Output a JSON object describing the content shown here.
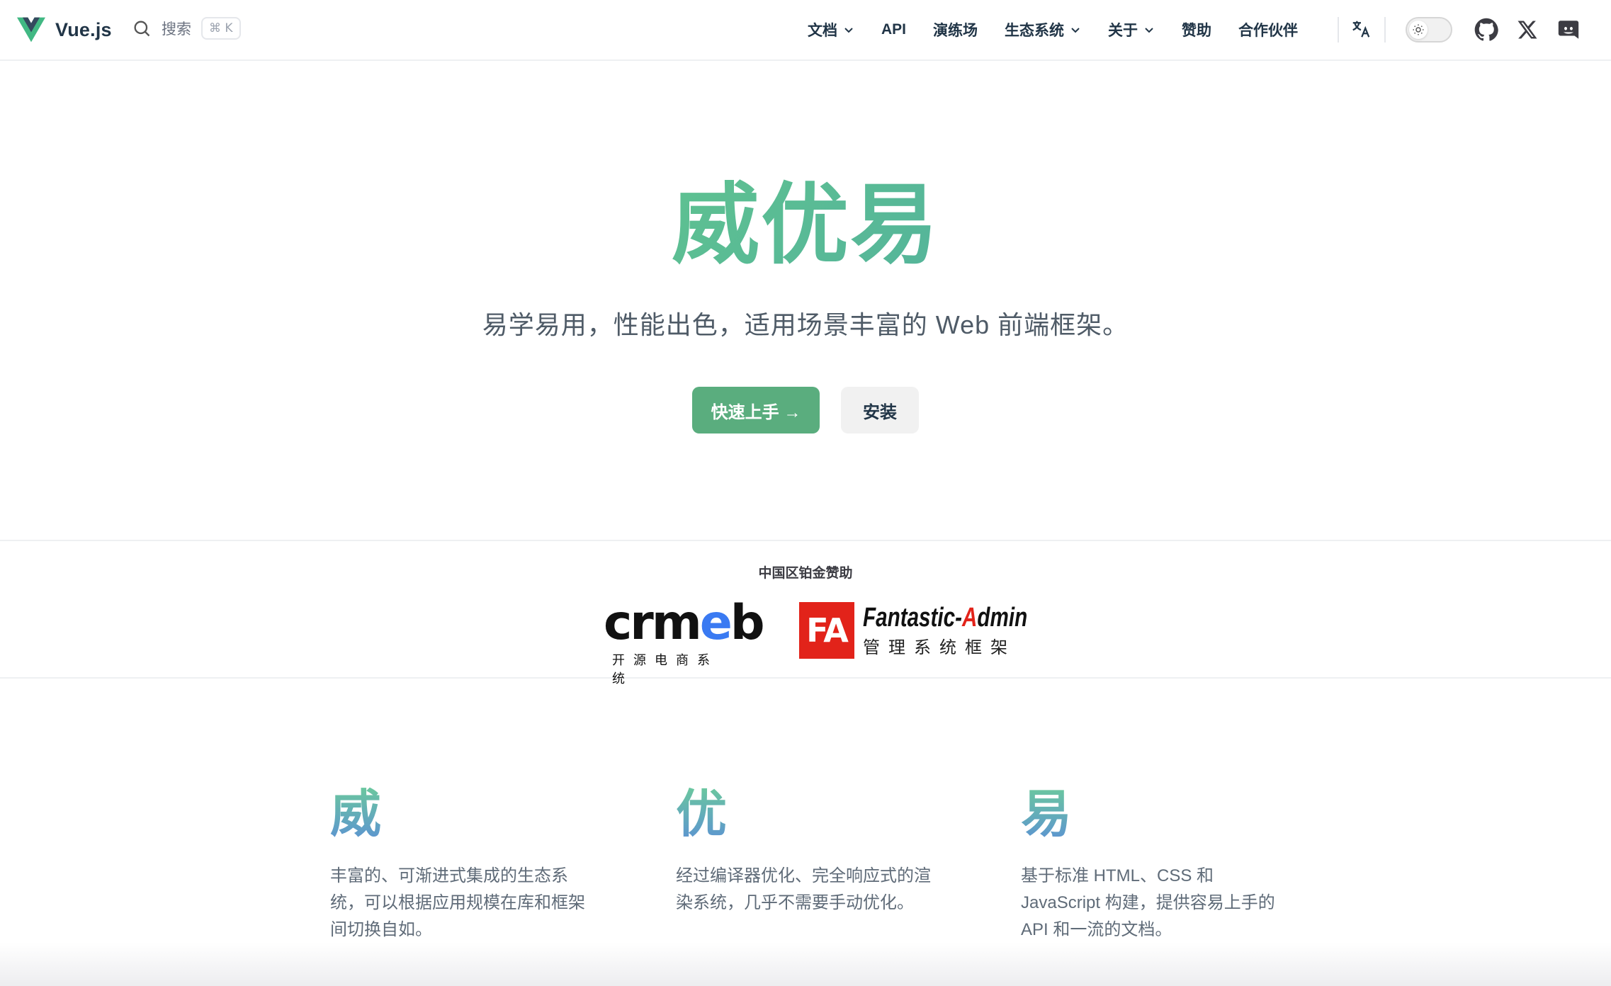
{
  "nav": {
    "site_title": "Vue.js",
    "search_label": "搜索",
    "search_shortcut": "⌘ K",
    "links": [
      {
        "label": "文档",
        "dropdown": true
      },
      {
        "label": "API",
        "dropdown": false
      },
      {
        "label": "演练场",
        "dropdown": false
      },
      {
        "label": "生态系统",
        "dropdown": true
      },
      {
        "label": "关于",
        "dropdown": true
      },
      {
        "label": "赞助",
        "dropdown": false
      },
      {
        "label": "合作伙伴",
        "dropdown": false
      }
    ],
    "icons": [
      "translate-icon",
      "theme-toggle",
      "github-icon",
      "x-icon",
      "discord-icon"
    ]
  },
  "hero": {
    "title": "威优易",
    "subtitle": "易学易用，性能出色，适用场景丰富的 Web 前端框架。",
    "primary_button": "快速上手 →",
    "secondary_button": "安装"
  },
  "sponsors": {
    "title": "中国区铂金赞助",
    "crmeb": {
      "word_a": "crm",
      "word_e": "e",
      "word_b": "b",
      "subtitle": "开源电商系统"
    },
    "fantastic_admin": {
      "box": "FA",
      "name_a": "Fantastic-",
      "name_b": "A",
      "name_c": "dmin",
      "subtitle": "管理系统框架"
    }
  },
  "features": [
    {
      "title": "威",
      "text": "丰富的、可渐进式集成的生态系统，可以根据应用规模在库和框架间切换自如。"
    },
    {
      "title": "优",
      "text": "经过编译器优化、完全响应式的渲染系统，几乎不需要手动优化。"
    },
    {
      "title": "易",
      "text": "基于标准 HTML、CSS 和 JavaScript 构建，提供容易上手的 API 和一流的文档。"
    }
  ],
  "colors": {
    "brand_green": "#42b883",
    "text": "#213547",
    "gradient_blue": "#6f7fe8"
  }
}
